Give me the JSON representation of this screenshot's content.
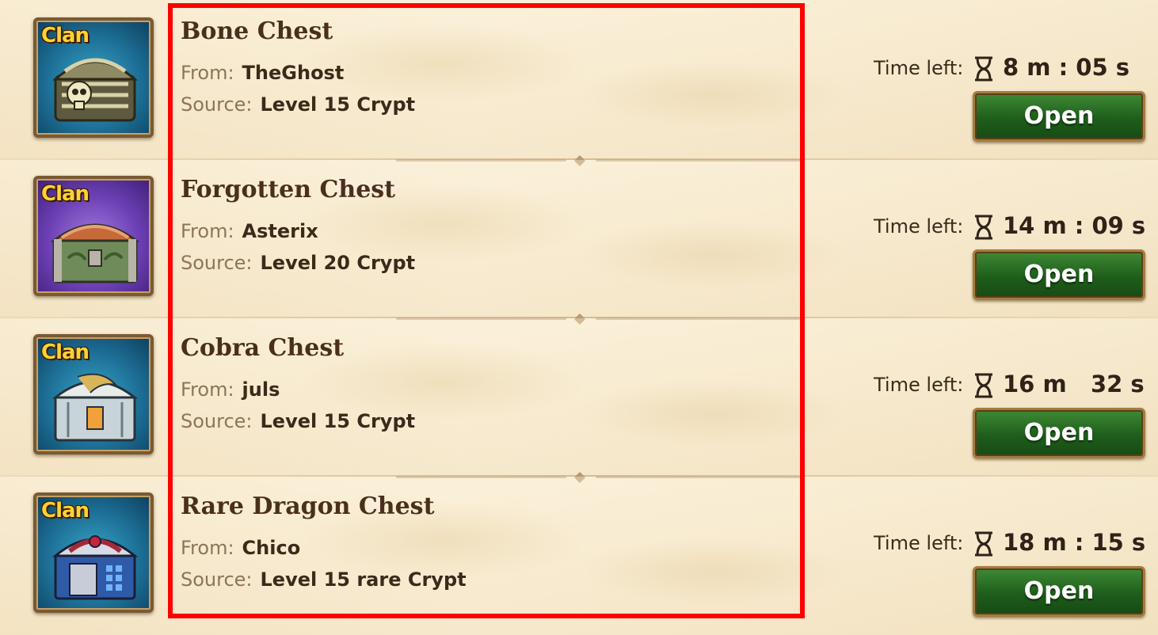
{
  "badge_label": "Clan",
  "time_left_label": "Time left:",
  "from_label": "From:",
  "source_label": "Source:",
  "open_label": "Open",
  "chests": [
    {
      "title": "Bone Chest",
      "from": "TheGhost",
      "source": "Level 15 Crypt",
      "time": "8 m : 05 s",
      "icon": "bone-chest-icon"
    },
    {
      "title": "Forgotten Chest",
      "from": "Asterix",
      "source": "Level 20 Crypt",
      "time": "14 m : 09 s",
      "icon": "forgotten-chest-icon"
    },
    {
      "title": "Cobra Chest",
      "from": "juls",
      "source": "Level 15 Crypt",
      "time": "16 m   32 s",
      "icon": "cobra-chest-icon"
    },
    {
      "title": "Rare Dragon Chest",
      "from": "Chico",
      "source": "Level 15 rare Crypt",
      "time": "18 m : 15 s",
      "icon": "rare-dragon-chest-icon"
    }
  ],
  "colors": {
    "highlight": "#ff0000",
    "button_green": "#1f5e1c",
    "badge_gold": "#ffd233"
  }
}
